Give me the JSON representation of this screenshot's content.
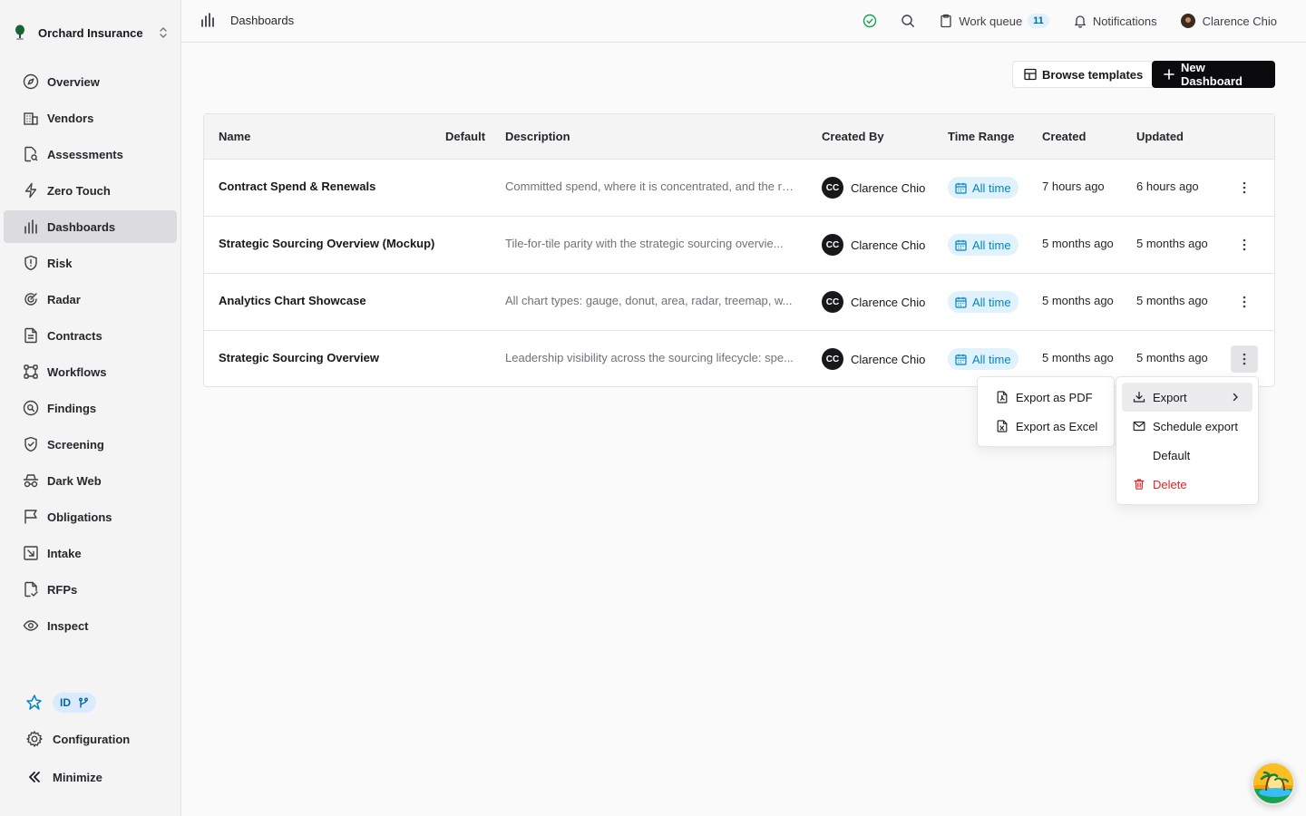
{
  "org": {
    "name": "Orchard Insurance"
  },
  "sidebar": {
    "items": [
      {
        "label": "Overview",
        "icon": "compass-icon"
      },
      {
        "label": "Vendors",
        "icon": "building-icon"
      },
      {
        "label": "Assessments",
        "icon": "file-search-icon"
      },
      {
        "label": "Zero Touch",
        "icon": "zap-icon"
      },
      {
        "label": "Dashboards",
        "icon": "bar-chart-icon",
        "active": true
      },
      {
        "label": "Risk",
        "icon": "shield-alert-icon"
      },
      {
        "label": "Radar",
        "icon": "radar-icon"
      },
      {
        "label": "Contracts",
        "icon": "file-text-icon"
      },
      {
        "label": "Workflows",
        "icon": "workflow-icon"
      },
      {
        "label": "Findings",
        "icon": "search-circle-icon"
      },
      {
        "label": "Screening",
        "icon": "shield-check-icon"
      },
      {
        "label": "Dark Web",
        "icon": "incognito-icon"
      },
      {
        "label": "Obligations",
        "icon": "flag-icon"
      },
      {
        "label": "Intake",
        "icon": "inbox-arrow-icon"
      },
      {
        "label": "RFPs",
        "icon": "file-check-icon"
      },
      {
        "label": "Inspect",
        "icon": "eye-icon"
      }
    ],
    "identity_badge": "ID",
    "configuration_label": "Configuration",
    "minimize_label": "Minimize"
  },
  "topbar": {
    "breadcrumb": "Dashboards",
    "work_queue_label": "Work queue",
    "work_queue_count": "11",
    "notifications_label": "Notifications",
    "user_name": "Clarence Chio"
  },
  "actions": {
    "browse_templates": "Browse templates",
    "new_dashboard": "New Dashboard"
  },
  "table": {
    "columns": [
      "Name",
      "Default",
      "Description",
      "Created By",
      "Time Range",
      "Created",
      "Updated"
    ],
    "rows": [
      {
        "name": "Contract Spend & Renewals",
        "description": "Committed spend, where it is concentrated, and the re...",
        "creator_initials": "CC",
        "creator": "Clarence Chio",
        "time_range": "All time",
        "created": "7 hours ago",
        "updated": "6 hours ago"
      },
      {
        "name": "Strategic Sourcing Overview (Mockup)",
        "description": "Tile-for-tile parity with the strategic sourcing overvie...",
        "creator_initials": "CC",
        "creator": "Clarence Chio",
        "time_range": "All time",
        "created": "5 months ago",
        "updated": "5 months ago"
      },
      {
        "name": "Analytics Chart Showcase",
        "description": "All chart types: gauge, donut, area, radar, treemap, w...",
        "creator_initials": "CC",
        "creator": "Clarence Chio",
        "time_range": "All time",
        "created": "5 months ago",
        "updated": "5 months ago"
      },
      {
        "name": "Strategic Sourcing Overview",
        "description": "Leadership visibility across the sourcing lifecycle: spe...",
        "creator_initials": "CC",
        "creator": "Clarence Chio",
        "time_range": "All time",
        "created": "5 months ago",
        "updated": "5 months ago"
      }
    ]
  },
  "row_menu": {
    "export": "Export",
    "schedule_export": "Schedule export",
    "default": "Default",
    "delete": "Delete"
  },
  "export_submenu": {
    "pdf": "Export as PDF",
    "excel": "Export as Excel"
  },
  "colors": {
    "accent_blue": "#0284c7",
    "danger": "#dc2626",
    "primary_dark": "#0b0b0d",
    "status_ok": "#16a34a"
  }
}
